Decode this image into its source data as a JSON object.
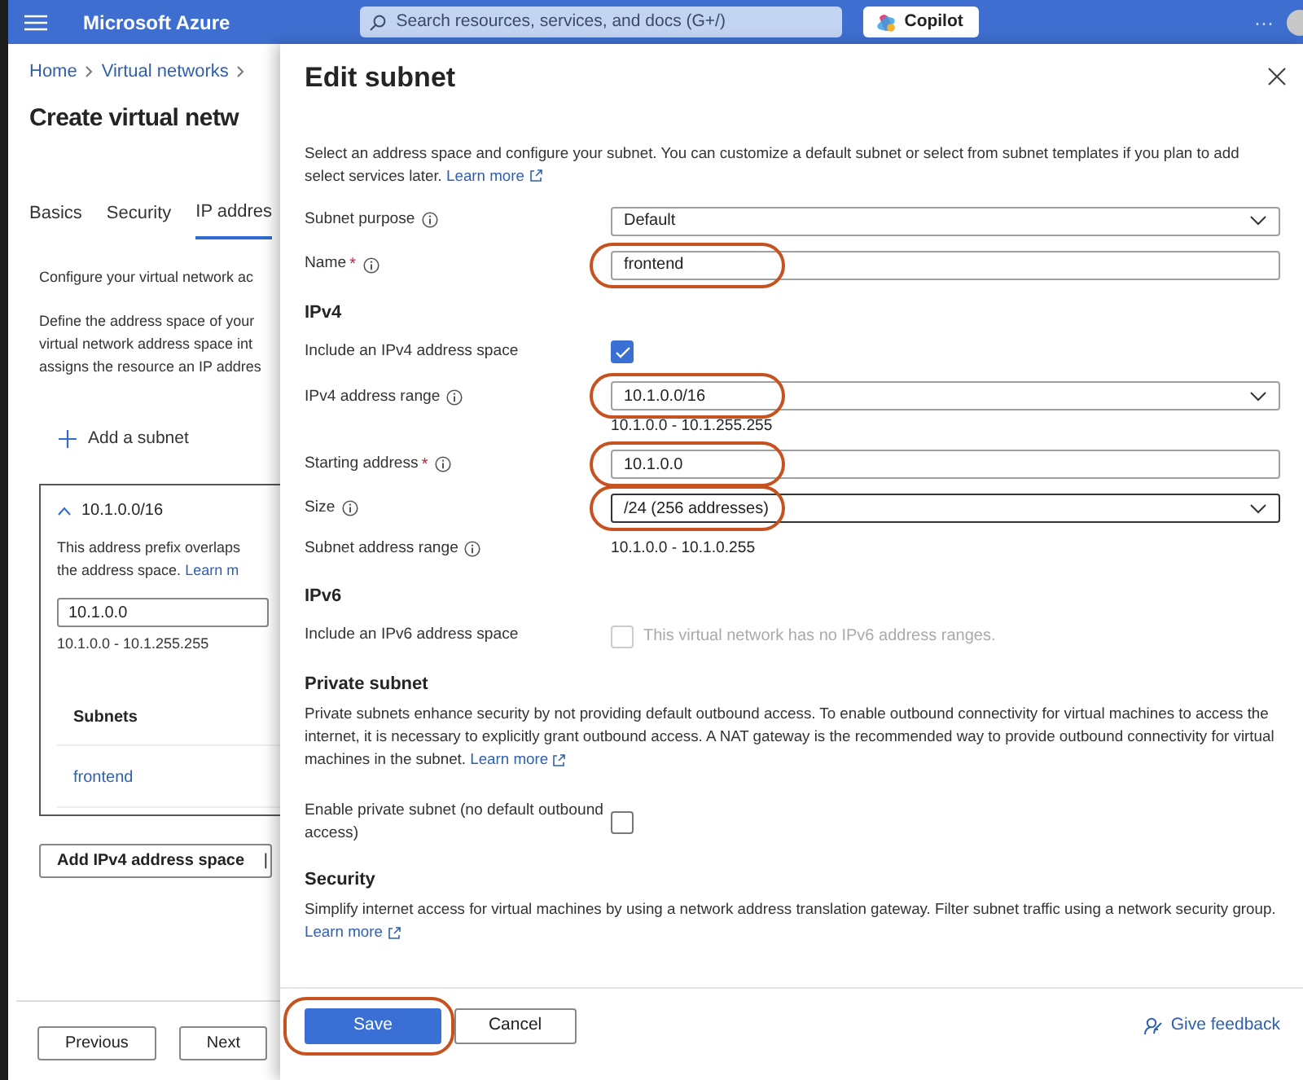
{
  "topbar": {
    "brand": "Microsoft Azure",
    "search_placeholder": "Search resources, services, and docs (G+/)",
    "copilot": "Copilot",
    "more": "···"
  },
  "page": {
    "breadcrumb": [
      "Home",
      "Virtual networks"
    ],
    "title": "Create virtual netw",
    "tabs": [
      {
        "label": "Basics",
        "selected": false
      },
      {
        "label": "Security",
        "selected": false
      },
      {
        "label": "IP addres",
        "selected": true
      }
    ],
    "intro": "Configure your virtual network ac",
    "define_lines": [
      "Define the address space of your",
      "virtual network address space int",
      "assigns the resource an IP addres"
    ],
    "add_subnet": "Add a subnet",
    "address_space": {
      "expanded": true,
      "prefix": "10.1.0.0/16",
      "warning_lines": [
        "This address prefix overlaps",
        "the address space."
      ],
      "warning_link": "Learn m",
      "start": "10.1.0.0",
      "range": "10.1.0.0 - 10.1.255.255",
      "subnets_heading": "Subnets",
      "subnets": [
        "frontend"
      ]
    },
    "add_space_button": "Add IPv4 address space",
    "add_space_divider": "|",
    "footer": [
      "Previous",
      "Next"
    ]
  },
  "panel": {
    "title": "Edit subnet",
    "sections": [
      {
        "description": "Select an address space and configure your subnet. You can customize a default subnet or select from subnet templates if you plan to add select services later.",
        "link": "Learn more",
        "fields": [
          {
            "kind": "select",
            "label": "Subnet purpose",
            "info": true,
            "value": "Default"
          },
          {
            "kind": "text",
            "label": "Name",
            "info": true,
            "required_mark": "*",
            "value": "frontend",
            "highlighted": true
          }
        ]
      },
      {
        "heading": "IPv4",
        "fields": [
          {
            "kind": "checkbox",
            "label": "Include an IPv4 address space",
            "checked": true
          },
          {
            "kind": "select",
            "label": "IPv4 address range",
            "info": true,
            "value": "10.1.0.0/16",
            "hint": "10.1.0.0 - 10.1.255.255",
            "highlighted": true
          },
          {
            "kind": "text",
            "label": "Starting address",
            "info": true,
            "required_mark": "*",
            "value": "10.1.0.0",
            "highlighted": true
          },
          {
            "kind": "select",
            "label": "Size",
            "info": true,
            "value": "/24 (256 addresses)",
            "highlighted": true,
            "focused": true
          },
          {
            "kind": "readonly",
            "label": "Subnet address range",
            "info": true,
            "value": "10.1.0.0 - 10.1.0.255"
          }
        ]
      },
      {
        "heading": "IPv6",
        "fields": [
          {
            "kind": "checkbox",
            "label": "Include an IPv6 address space",
            "checked": false,
            "disabled": true,
            "note": "This virtual network has no IPv6 address ranges."
          }
        ]
      },
      {
        "heading": "Private subnet",
        "description": "Private subnets enhance security by not providing default outbound access. To enable outbound connectivity for virtual machines to access the internet, it is necessary to explicitly grant outbound access. A NAT gateway is the recommended way to provide outbound connectivity for virtual machines in the subnet.",
        "link": "Learn more",
        "fields": [
          {
            "kind": "checkbox",
            "label": "Enable private subnet (no default outbound access)",
            "checked": false
          }
        ]
      },
      {
        "heading": "Security",
        "description": "Simplify internet access for virtual machines by using a network address translation gateway. Filter subnet traffic using a network security group.",
        "link": "Learn more"
      }
    ],
    "buttons": [
      {
        "label": "Save",
        "kind": "primary",
        "highlighted": true
      },
      {
        "label": "Cancel",
        "kind": "secondary"
      }
    ],
    "feedback": "Give feedback"
  }
}
